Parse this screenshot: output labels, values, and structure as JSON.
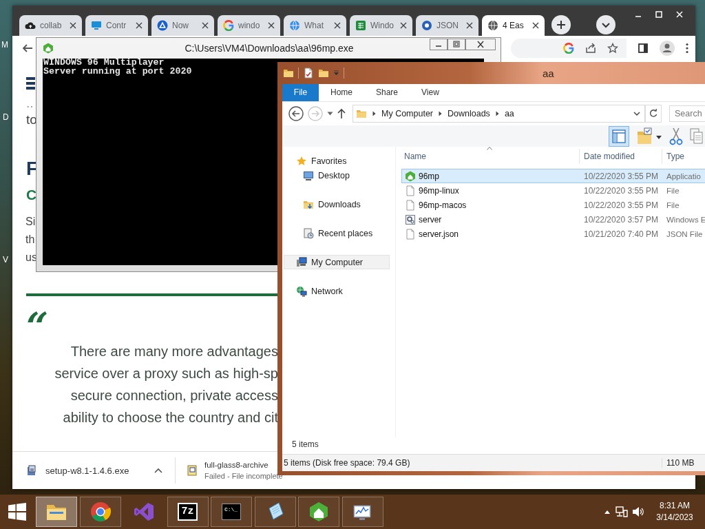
{
  "desktop": {
    "icon_labels": [
      "M",
      "D",
      "V"
    ]
  },
  "browser": {
    "tabs": [
      {
        "kind": "cloud",
        "label": "collab",
        "selected": false
      },
      {
        "kind": "monitor",
        "label": "Contr",
        "selected": false
      },
      {
        "kind": "triangle",
        "label": "Now",
        "selected": false
      },
      {
        "kind": "g",
        "label": "windo",
        "selected": false
      },
      {
        "kind": "globe",
        "label": "What",
        "selected": false
      },
      {
        "kind": "sheet",
        "label": "Windo",
        "selected": false
      },
      {
        "kind": "ring",
        "label": "JSON",
        "selected": false
      },
      {
        "kind": "globe-grey",
        "label": "4 Eas",
        "selected": true
      }
    ],
    "page": {
      "intro_lines": [
        "..",
        "to"
      ],
      "heading": "F",
      "subheading": "C",
      "paragraph_lines": [
        "Si",
        "th",
        "us"
      ],
      "quote_mark": "“",
      "quote_lines": [
        "There are many more advantages",
        "service over a proxy such as high-sp",
        "secure connection, private access",
        "ability to choose the country and cit"
      ]
    },
    "downloads": [
      {
        "kind": "installer",
        "name": "setup-w8.1-1.4.6.exe"
      },
      {
        "kind": "archive",
        "name": "full-glass8-archive",
        "status": "Failed - File incomplete"
      }
    ]
  },
  "console": {
    "title": "C:\\Users\\VM4\\Downloads\\aa\\96mp.exe",
    "lines": [
      "WINDOWS 96 Multiplayer",
      "Server running at port 2020"
    ]
  },
  "explorer": {
    "title": "aa",
    "ribbon_tabs": [
      {
        "kind": "menu",
        "label": "File"
      },
      {
        "kind": "tab",
        "label": "Home"
      },
      {
        "kind": "tab",
        "label": "Share"
      },
      {
        "kind": "tab",
        "label": "View"
      }
    ],
    "breadcrumb": [
      "My Computer",
      "Downloads",
      "aa"
    ],
    "search": {
      "placeholder": "Search"
    },
    "nav": [
      {
        "kind": "favorites",
        "label": "Favorites",
        "selected": false,
        "children": [
          {
            "kind": "desktop",
            "label": "Desktop",
            "selected": false
          },
          {
            "kind": "downloads",
            "label": "Downloads",
            "selected": false
          },
          {
            "kind": "recent",
            "label": "Recent places",
            "selected": false
          }
        ]
      },
      {
        "kind": "computer",
        "label": "My Computer",
        "selected": true
      },
      {
        "kind": "network",
        "label": "Network",
        "selected": false
      }
    ],
    "columns": [
      "Name",
      "Date modified",
      "Type"
    ],
    "files": [
      {
        "kind": "app",
        "name": "96mp",
        "date": "10/22/2020 3:55 PM",
        "type": "Applicatio",
        "selected": true
      },
      {
        "kind": "file",
        "name": "96mp-linux",
        "date": "10/22/2020 3:55 PM",
        "type": "File",
        "selected": false
      },
      {
        "kind": "file",
        "name": "96mp-macos",
        "date": "10/22/2020 3:55 PM",
        "type": "File",
        "selected": false
      },
      {
        "kind": "settings",
        "name": "server",
        "date": "10/22/2020 3:57 PM",
        "type": "Windows E",
        "selected": false
      },
      {
        "kind": "file",
        "name": "server.json",
        "date": "10/21/2020 7:40 PM",
        "type": "JSON File",
        "selected": false
      }
    ],
    "item_count": "5 items",
    "status": {
      "text": "5 items (Disk free space: 79.4 GB)",
      "size": "110 MB"
    }
  },
  "taskbar": {
    "apps": [
      {
        "kind": "explorer",
        "running": true,
        "selected": true
      },
      {
        "kind": "chrome",
        "running": true,
        "selected": false
      },
      {
        "kind": "studio",
        "running": false,
        "selected": false
      },
      {
        "kind": "archiver",
        "running": true,
        "selected": false,
        "icon_text": "7z"
      },
      {
        "kind": "console",
        "running": true,
        "selected": false,
        "icon_text": "C:\\_"
      },
      {
        "kind": "notepad",
        "running": true,
        "selected": false
      },
      {
        "kind": "hex",
        "running": true,
        "selected": false
      },
      {
        "kind": "monitor",
        "running": true,
        "selected": false
      }
    ],
    "clock": {
      "time": "8:31 AM",
      "date": "3/14/2023"
    }
  }
}
